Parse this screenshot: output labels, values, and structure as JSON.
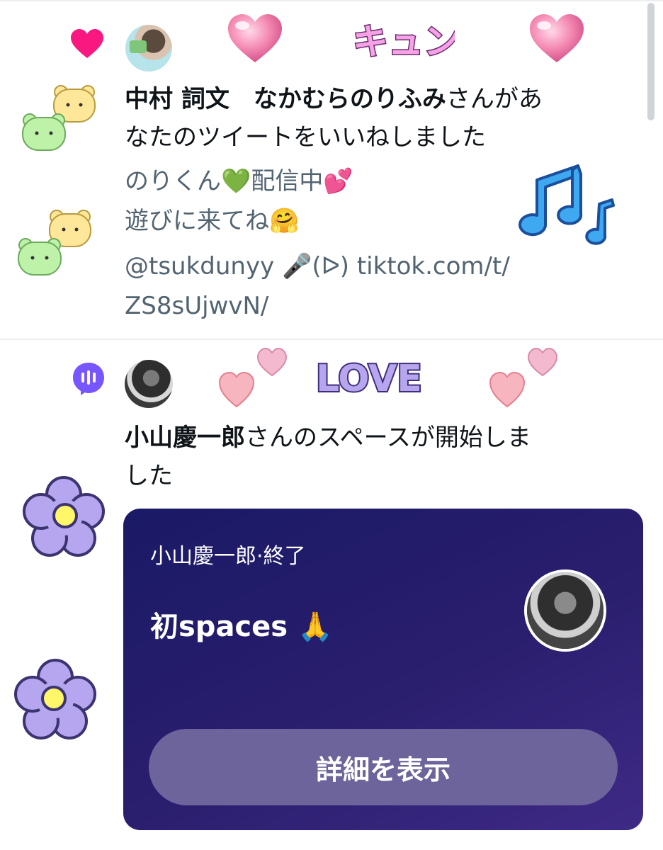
{
  "notifications": [
    {
      "type": "like",
      "icon": "heart-icon",
      "user_name": "中村 詞文　なかむらのりふみ",
      "action_line1_suffix": "さんがあ",
      "action_line2": "なたのツイートをいいねしました",
      "tweet_lines": [
        "のりくん💚配信中💕",
        "遊びに来てね🤗",
        "@tsukdunyy 🎤(ᐅ) tiktok.com/t/",
        "ZS8sUjwvN/"
      ]
    },
    {
      "type": "space",
      "icon": "spaces-icon",
      "user_name": "小山慶一郎",
      "action_line1_suffix": "さんのスペースが開始しま",
      "action_line2": "した",
      "card": {
        "meta": "小山慶一郎·終了",
        "title": "初spaces 🙏",
        "button_label": "詳細を表示"
      }
    }
  ],
  "stickers": {
    "kyun": "キュン",
    "love": "LOVE"
  },
  "colors": {
    "like_heart": "#f91880",
    "spaces_purple": "#7856ff",
    "card_start": "#1a1a66",
    "card_end": "#3e2a86",
    "card_button": "#6c649a",
    "secondary_text": "#536471"
  }
}
